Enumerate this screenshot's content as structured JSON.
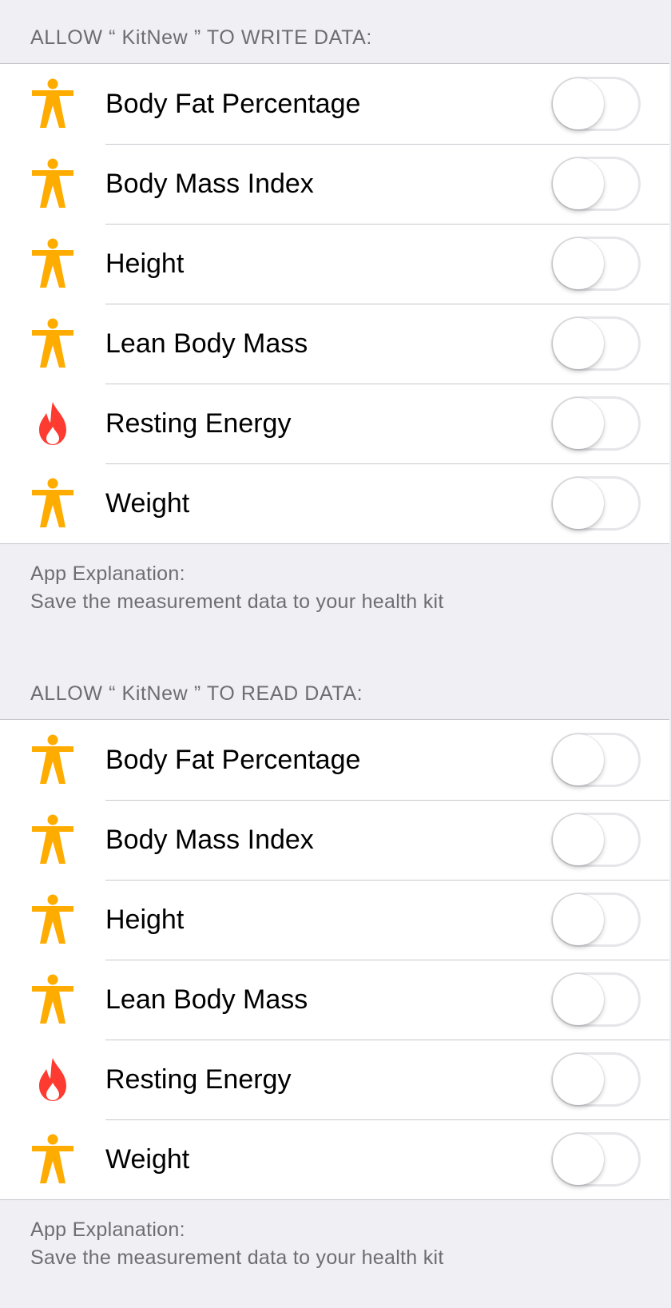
{
  "write_section": {
    "header": "ALLOW “ KitNew ” TO WRITE DATA:",
    "items": [
      {
        "label": "Body Fat Percentage",
        "icon": "body-figure-icon",
        "enabled": false
      },
      {
        "label": "Body Mass Index",
        "icon": "body-figure-icon",
        "enabled": false
      },
      {
        "label": "Height",
        "icon": "body-figure-icon",
        "enabled": false
      },
      {
        "label": "Lean Body Mass",
        "icon": "body-figure-icon",
        "enabled": false
      },
      {
        "label": "Resting Energy",
        "icon": "flame-icon",
        "enabled": false
      },
      {
        "label": "Weight",
        "icon": "body-figure-icon",
        "enabled": false
      }
    ],
    "footer_title": "App Explanation:",
    "footer_text": "Save the measurement data to your health kit"
  },
  "read_section": {
    "header": "ALLOW “ KitNew ” TO READ DATA:",
    "items": [
      {
        "label": "Body Fat Percentage",
        "icon": "body-figure-icon",
        "enabled": false
      },
      {
        "label": "Body Mass Index",
        "icon": "body-figure-icon",
        "enabled": false
      },
      {
        "label": "Height",
        "icon": "body-figure-icon",
        "enabled": false
      },
      {
        "label": "Lean Body Mass",
        "icon": "body-figure-icon",
        "enabled": false
      },
      {
        "label": "Resting Energy",
        "icon": "flame-icon",
        "enabled": false
      },
      {
        "label": "Weight",
        "icon": "body-figure-icon",
        "enabled": false
      }
    ],
    "footer_title": "App Explanation:",
    "footer_text": "Save the measurement data to your health kit"
  },
  "colors": {
    "body_icon": "#ffac00",
    "flame_icon": "#fe3b30",
    "background": "#efeff4",
    "separator": "#c8c7cc",
    "secondary_text": "#6d6d72",
    "toggle_track_border": "#e5e5ea",
    "toggle_on": "#4cd964"
  }
}
